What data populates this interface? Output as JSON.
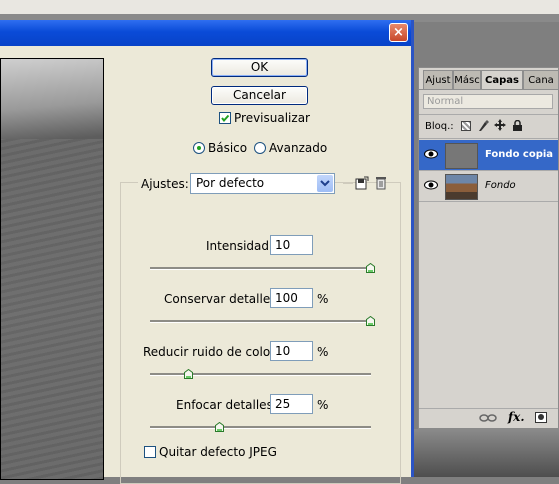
{
  "dialog": {
    "close_icon": "×",
    "ok_label": "OK",
    "cancel_label": "Cancelar",
    "preview_label": "Previsualizar",
    "preview_checked": true,
    "mode_basic_label": "Básico",
    "mode_advanced_label": "Avanzado",
    "mode_selected": "basic",
    "settings_label": "Ajustes:",
    "settings_value": "Por defecto",
    "sliders": [
      {
        "label": "Intensidad:",
        "value": "10",
        "unit": "",
        "level": 1.0
      },
      {
        "label": "Conservar detalles:",
        "value": "100",
        "unit": "%",
        "level": 1.0
      },
      {
        "label": "Reducir ruido de color:",
        "value": "10",
        "unit": "%",
        "level": 0.1
      },
      {
        "label": "Enfocar detalles:",
        "value": "25",
        "unit": "%",
        "level": 0.25
      }
    ],
    "jpeg_label": "Quitar defecto JPEG",
    "jpeg_checked": false
  },
  "layers_panel": {
    "tabs": [
      "Ajust",
      "Másc",
      "Capas",
      "Cana"
    ],
    "active_tab": "Capas",
    "blend_mode": "Normal",
    "lock_label": "Bloq.:",
    "layers": [
      {
        "name": "Fondo copia",
        "selected": true
      },
      {
        "name": "Fondo",
        "selected": false
      }
    ],
    "footer_fx": "fx."
  },
  "colors": {
    "titlebar": "#0a4bd8",
    "selection": "#3568c8",
    "dialog_bg": "#ece9d8"
  }
}
